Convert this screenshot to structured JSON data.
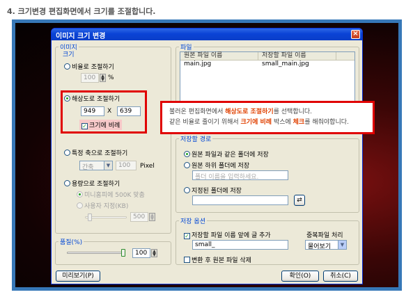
{
  "caption": "4. 크기변경 편집화면에서 크기를 조절합니다.",
  "window": {
    "title": "이미지 크기 변경",
    "close_glyph": "×"
  },
  "image_group": {
    "label": "이미지",
    "size_label": "크기",
    "ratio": {
      "label": "비율로 조절하기",
      "value": "100",
      "unit": "%"
    },
    "resolution": {
      "label": "해상도로 조절하기",
      "width": "949",
      "times": "X",
      "height": "639",
      "keep_ratio_label": "크기에 비례"
    },
    "axis": {
      "label": "특정 축으로 조절하기",
      "select_value": "간축",
      "value": "100",
      "unit": "Pixel"
    },
    "capacity": {
      "label": "용량으로 조절하기",
      "option1": "미니홈피에 500K 맞춤",
      "option2": "사용자 지정(KB)",
      "value": "500"
    }
  },
  "quality": {
    "label": "품질(%)",
    "value": "100",
    "level_percent": 100
  },
  "file_group": {
    "label": "파일",
    "columns": [
      "원본 파일 이름",
      "저장할 파일 이름"
    ],
    "rows": [
      [
        "main.jpg",
        "small_main.jpg"
      ]
    ]
  },
  "save_path": {
    "label": "저장할 경로",
    "option1": "원본 파일과 같은 폴더에 저장",
    "option2": "원본 하위 폴더에 저장",
    "subfolder_placeholder": "폴더 이름을 입력하세요.",
    "option3": "지정된 폴더에 저장",
    "folder_value": ""
  },
  "save_options": {
    "label": "저장 옵션",
    "prefix_label": "저장할 파일 이름 앞에 글 추가",
    "prefix_value": "small_",
    "duplicate_label": "중복파일 처리",
    "duplicate_value": "물어보기",
    "delete_label": "변환 후 원본 파일 삭제"
  },
  "buttons": {
    "preview": "미리보기(P)",
    "ok": "확인(O)",
    "cancel": "취소(C)"
  },
  "callout": {
    "line1_a": "불러온 편집화면에서 ",
    "line1_hl": "해상도로 조절하기",
    "line1_b": "를 선택합니다.",
    "line2_a": "같은 비율로 줄이기 위해서 ",
    "line2_hl1": "크기에 비례",
    "line2_b": " 박스에 ",
    "line2_hl2": "체크",
    "line2_c": "를 해줘야합니다."
  },
  "colors": {
    "accent": "#e00000",
    "titlebar": "#0a43d6",
    "frame": "#3778b8"
  }
}
